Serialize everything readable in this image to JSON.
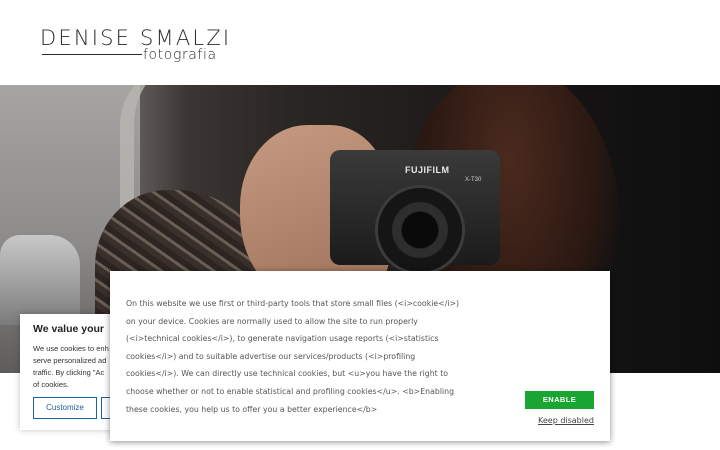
{
  "logo": {
    "name": "DENISE SMALZI",
    "subtitle": "fotografia"
  },
  "hero": {
    "camera_brand": "FUJIFILM",
    "camera_model": "X-T30"
  },
  "privacy_panel": {
    "title": "We value your",
    "text": "We use cookies to enh\nserve personalized ad\ntraffic. By clicking \"Ac\nof cookies.",
    "customize_label": "Customize"
  },
  "cookie_banner": {
    "text": "On this website we use first or third-party tools that store small files (<i>cookie</i>)\non your device. Cookies are normally used to allow the site to run properly\n(<i>technical cookies</i>), to generate navigation usage reports (<i>statistics\ncookies</i>) and to suitable advertise our services/products (<i>profiling\ncookies</i>). We can directly use technical cookies, but <u>you have the right to\nchoose whether or not to enable statistical and profiling cookies</u>. <b>Enabling\nthese cookies, you help us to offer you a better experience</b>",
    "enable_label": "ENABLE",
    "keep_disabled_label": "Keep disabled"
  },
  "colors": {
    "enable_button": "#19a532",
    "customize_border": "#1e5fa0"
  }
}
